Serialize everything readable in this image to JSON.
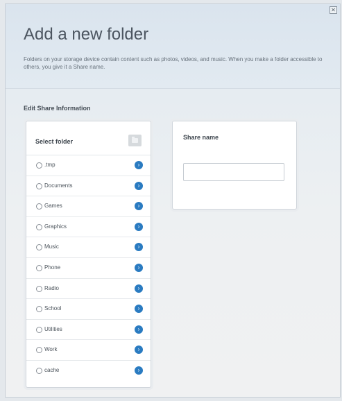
{
  "dialog": {
    "close_label": "✕",
    "title": "Add a new folder",
    "description": "Folders on your storage device contain content such as photos, videos, and music. When you make a folder accessible to others, you give it a Share name."
  },
  "section": {
    "title": "Edit Share Information"
  },
  "folders": {
    "header": "Select folder",
    "items": [
      {
        "label": ".tmp"
      },
      {
        "label": "Documents"
      },
      {
        "label": "Games"
      },
      {
        "label": "Graphics"
      },
      {
        "label": "Music"
      },
      {
        "label": "Phone"
      },
      {
        "label": "Radio"
      },
      {
        "label": "School"
      },
      {
        "label": "Utilities"
      },
      {
        "label": "Work"
      },
      {
        "label": "cache"
      }
    ]
  },
  "share": {
    "header": "Share name",
    "value": "",
    "placeholder": ""
  },
  "colors": {
    "accent": "#2a7bc1",
    "header_bg": "#dae4ee"
  },
  "icons": {
    "open_folder": "chevron-right-circle-icon",
    "new_folder": "folder-icon"
  }
}
